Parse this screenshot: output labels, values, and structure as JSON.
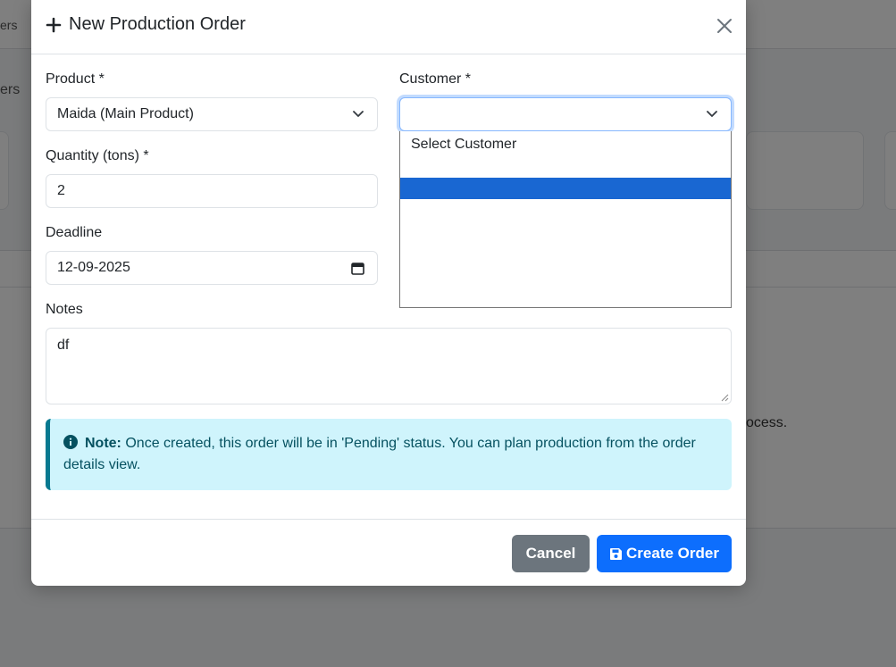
{
  "background": {
    "nav_fragment": "ers",
    "subtitle_fragment": "ers",
    "body_fragment": "ocess."
  },
  "modal": {
    "title": "New Production Order",
    "fields": {
      "product": {
        "label": "Product *",
        "value": "Maida (Main Product)"
      },
      "customer": {
        "label": "Customer *",
        "value": ""
      },
      "quantity": {
        "label": "Quantity (tons) *",
        "value": "2"
      },
      "deadline": {
        "label": "Deadline",
        "value": "12-09-2025"
      },
      "notes": {
        "label": "Notes",
        "value": "df"
      }
    },
    "customer_dropdown": {
      "options": [
        "Select Customer",
        ""
      ],
      "highlighted_index": 1
    },
    "alert": {
      "prefix": "Note:",
      "text": "Once created, this order will be in 'Pending' status. You can plan production from the order details view."
    },
    "footer": {
      "cancel_label": "Cancel",
      "create_label": "Create Order"
    }
  },
  "colors": {
    "primary": "#0d6efd",
    "secondary": "#6c757d",
    "info_bg": "#cff4fc",
    "info_text": "#055160",
    "option_highlight": "#1967d2"
  }
}
